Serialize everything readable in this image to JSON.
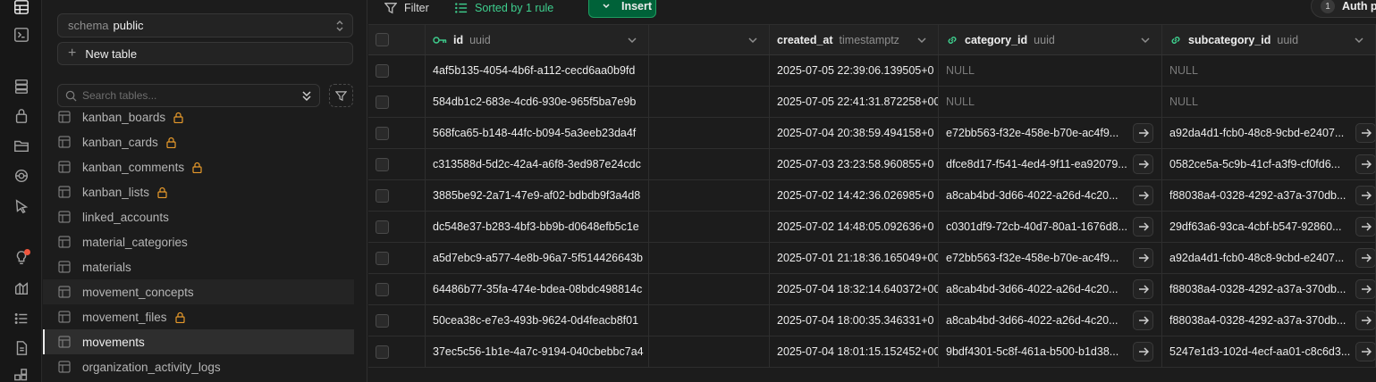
{
  "rail": {
    "icons": [
      "table-editor-icon",
      "sql-editor-icon",
      "database-icon",
      "auth-icon",
      "storage-icon",
      "realtime-icon",
      "edge-functions-icon",
      "advisors-icon",
      "reports-icon",
      "logs-icon",
      "api-docs-icon",
      "integrations-icon"
    ]
  },
  "sidebar": {
    "schema_label": "schema",
    "schema_value": "public",
    "new_table_label": "New table",
    "search_placeholder": "Search tables...",
    "tables": [
      {
        "name": "kanban_boards",
        "locked": true
      },
      {
        "name": "kanban_cards",
        "locked": true
      },
      {
        "name": "kanban_comments",
        "locked": true
      },
      {
        "name": "kanban_lists",
        "locked": true
      },
      {
        "name": "linked_accounts",
        "locked": false
      },
      {
        "name": "material_categories",
        "locked": false
      },
      {
        "name": "materials",
        "locked": false
      },
      {
        "name": "movement_concepts",
        "locked": false
      },
      {
        "name": "movement_files",
        "locked": true
      },
      {
        "name": "movements",
        "locked": false
      },
      {
        "name": "organization_activity_logs",
        "locked": false
      }
    ],
    "active_table": "movements"
  },
  "toolbar": {
    "filter_label": "Filter",
    "sorted_label": "Sorted by 1 rule",
    "insert_label": "Insert",
    "auth_count": "1",
    "auth_label": "Auth po"
  },
  "columns": [
    {
      "name": "id",
      "type": "uuid",
      "key": "primary"
    },
    {
      "name": "",
      "type": "",
      "key": ""
    },
    {
      "name": "created_at",
      "type": "timestamptz",
      "key": ""
    },
    {
      "name": "category_id",
      "type": "uuid",
      "key": "foreign"
    },
    {
      "name": "subcategory_id",
      "type": "uuid",
      "key": "foreign"
    }
  ],
  "rows": [
    {
      "id": "4af5b135-4054-4b6f-a112-cecd6aa0b9fd",
      "created_at": "2025-07-05 22:39:06.139505+0",
      "category_id": "NULL",
      "subcategory_id": "NULL"
    },
    {
      "id": "584db1c2-683e-4cd6-930e-965f5ba7e9b",
      "created_at": "2025-07-05 22:41:31.872258+00",
      "category_id": "NULL",
      "subcategory_id": "NULL"
    },
    {
      "id": "568fca65-b148-44fc-b094-5a3eeb23da4f",
      "created_at": "2025-07-04 20:38:59.494158+0",
      "category_id": "e72bb563-f32e-458e-b70e-ac4f9...",
      "subcategory_id": "a92da4d1-fcb0-48c8-9cbd-e2407..."
    },
    {
      "id": "c313588d-5d2c-42a4-a6f8-3ed987e24cdc",
      "created_at": "2025-07-03 23:23:58.960855+0",
      "category_id": "dfce8d17-f541-4ed4-9f11-ea92079...",
      "subcategory_id": "0582ce5a-5c9b-41cf-a3f9-cf0fd6..."
    },
    {
      "id": "3885be92-2a71-47e9-af02-bdbdb9f3a4d8",
      "created_at": "2025-07-02 14:42:36.026985+0",
      "category_id": "a8cab4bd-3d66-4022-a26d-4c20...",
      "subcategory_id": "f88038a4-0328-4292-a37a-370db..."
    },
    {
      "id": "dc548e37-b283-4bf3-bb9b-d0648efb5c1e",
      "created_at": "2025-07-02 14:48:05.092636+0",
      "category_id": "c0301df9-72cb-40d7-80a1-1676d8...",
      "subcategory_id": "29df63a6-93ca-4cbf-b547-92860..."
    },
    {
      "id": "a5d7ebc9-a577-4e8b-96a7-5f514426643b",
      "created_at": "2025-07-01 21:18:36.165049+00",
      "category_id": "e72bb563-f32e-458e-b70e-ac4f9...",
      "subcategory_id": "a92da4d1-fcb0-48c8-9cbd-e2407..."
    },
    {
      "id": "64486b77-35fa-474e-bdea-08bdc498814c",
      "created_at": "2025-07-04 18:32:14.640372+00",
      "category_id": "a8cab4bd-3d66-4022-a26d-4c20...",
      "subcategory_id": "f88038a4-0328-4292-a37a-370db..."
    },
    {
      "id": "50cea38c-e7e3-493b-9624-0d4feacb8f01",
      "created_at": "2025-07-04 18:00:35.346331+0",
      "category_id": "a8cab4bd-3d66-4022-a26d-4c20...",
      "subcategory_id": "f88038a4-0328-4292-a37a-370db..."
    },
    {
      "id": "37ec5c56-1b1e-4a7c-9194-040cbebbc7a4",
      "created_at": "2025-07-04 18:01:15.152452+00",
      "category_id": "9bdf4301-5c8f-461a-b500-b1d38...",
      "subcategory_id": "5247e1d3-102d-4ecf-aa01-c8c6d3..."
    }
  ],
  "colors": {
    "accent": "#3ecf8e",
    "insert_bg": "#006239",
    "lock": "#e89a2b",
    "notify_dot": "#f0553d"
  }
}
